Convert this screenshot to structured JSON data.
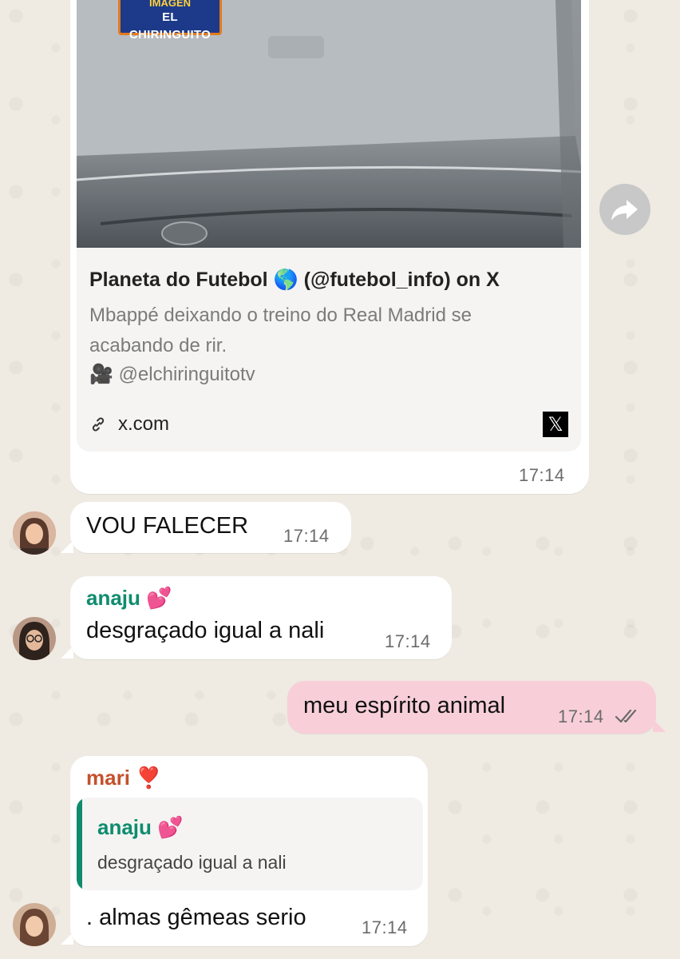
{
  "link_preview": {
    "thumbnail_badge_top": "IMAGEN",
    "thumbnail_badge_bottom": "EL CHIRINGUITO",
    "title": "Planeta do Futebol 🌎 (@futebol_info) on X",
    "desc_line1": "Mbappé deixando o treino do Real Madrid se",
    "desc_line2": "acabando de rir.",
    "credit_emoji": "🎥",
    "credit": "@elchiringuitotv",
    "domain": "x.com",
    "site_logo": "𝕏",
    "time": "17:14"
  },
  "messages": [
    {
      "id": "m1",
      "text": "VOU FALECER",
      "time": "17:14"
    },
    {
      "id": "m2",
      "sender": "anaju",
      "sender_emoji": "💕",
      "text": "desgraçado igual a nali",
      "time": "17:14"
    },
    {
      "id": "m3",
      "text": "meu espírito animal",
      "time": "17:14",
      "status_icon": "double-check-icon"
    },
    {
      "id": "m4",
      "sender": "mari",
      "sender_emoji": "❣️",
      "quote_sender": "anaju",
      "quote_emoji": "💕",
      "quote_text": "desgraçado igual a nali",
      "text": ". almas gêmeas serio",
      "time": "17:14"
    }
  ],
  "colors": {
    "background": "#efeae2",
    "outgoing_bubble": "#f8cfd8",
    "incoming_bubble": "#ffffff",
    "sender_anaju": "#0f8c6e",
    "sender_mari": "#c4512d",
    "preview_panel": "#f5f4f3"
  },
  "icons": {
    "forward": "forward-arrow-icon",
    "link": "link-icon",
    "x_logo": "x-logo-icon",
    "read_receipt": "double-check-icon"
  }
}
